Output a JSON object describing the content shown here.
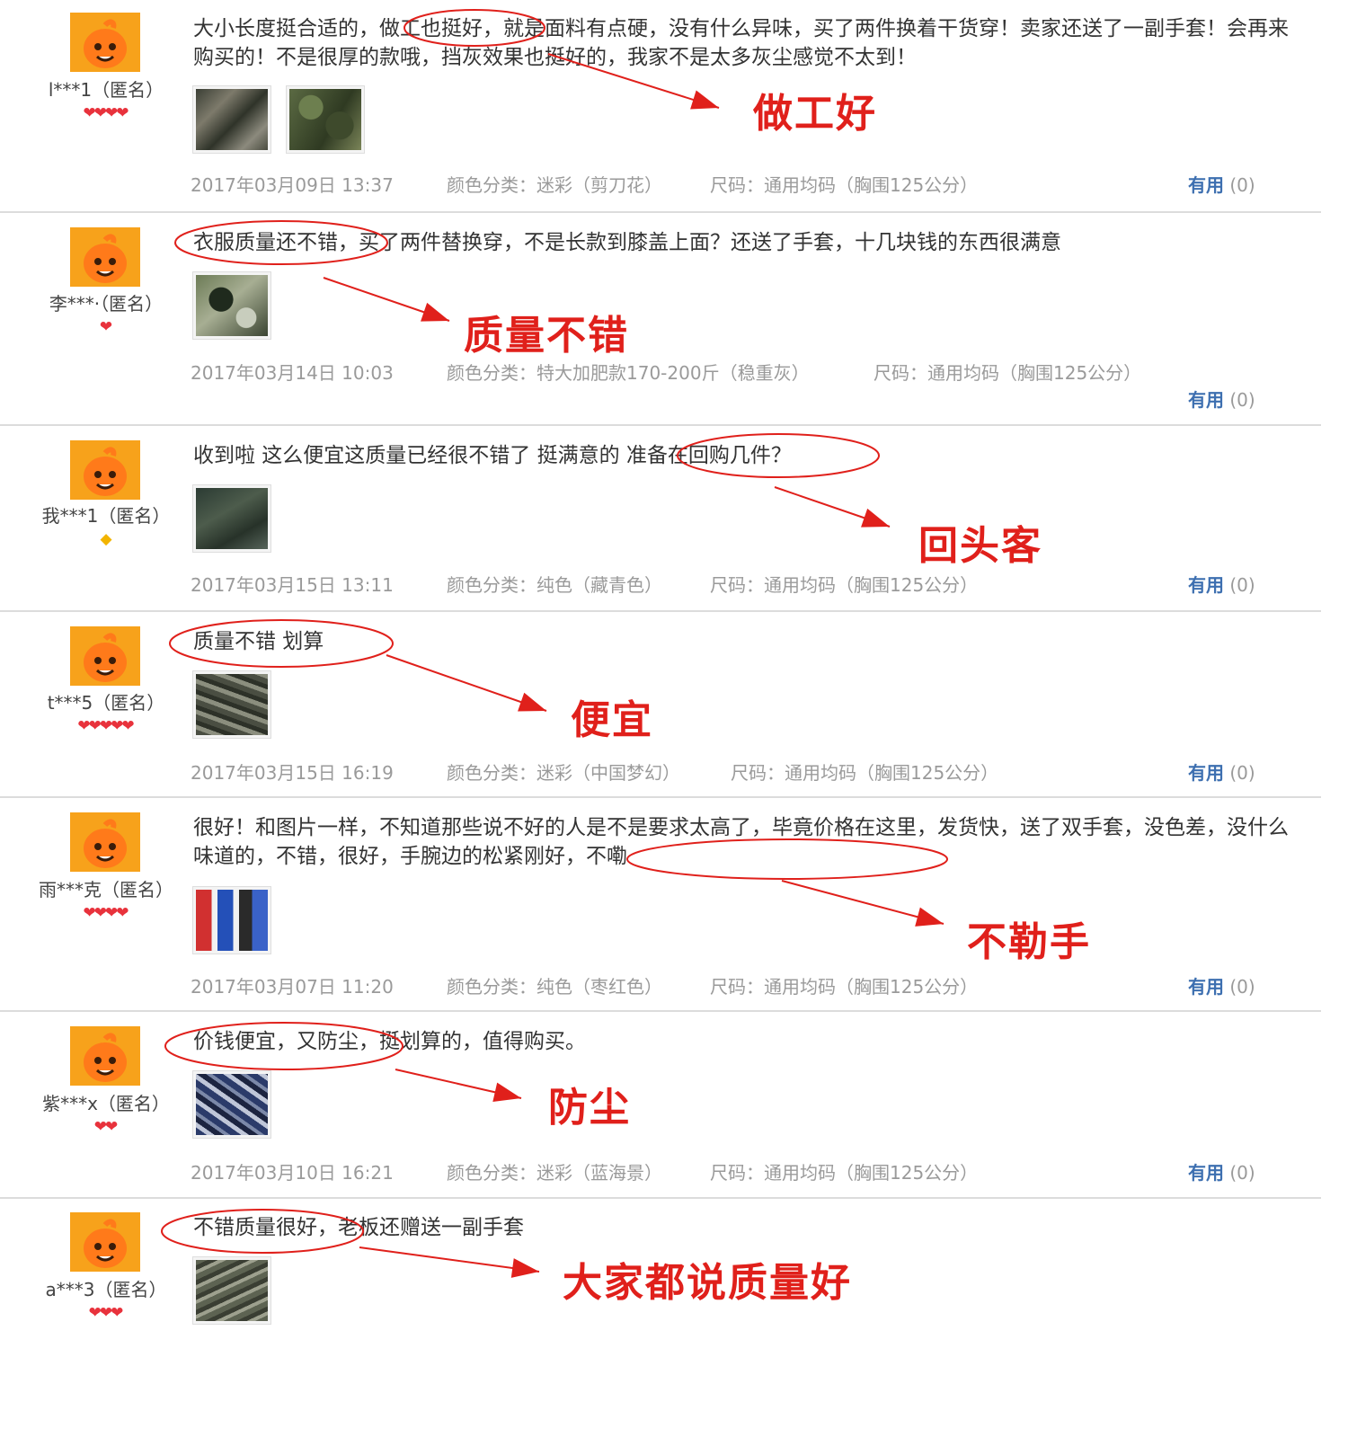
{
  "reviews": [
    {
      "user": "l***1（匿名）",
      "level": {
        "type": "heart",
        "count": 4
      },
      "text": "大小长度挺合适的，做工也挺好，就是面料有点硬，没有什么异味，买了两件换着干货穿！卖家还送了一副手套！会再来购买的！不是很厚的款哦，挡灰效果也挺好的，我家不是太多灰尘感觉不太到！",
      "photos": [
        "camo1",
        "camo2"
      ],
      "date": "2017年03月09日 13:37",
      "color": "颜色分类：迷彩（剪刀花）",
      "size": "尺码：通用均码（胸围125公分）",
      "useful_label": "有用",
      "useful_count": "(0)",
      "tag": "做工好"
    },
    {
      "user": "李***·（匿名）",
      "level": {
        "type": "heart",
        "count": 1
      },
      "text": "衣服质量还不错，买了两件替换穿，不是长款到膝盖上面？还送了手套，十几块钱的东西很满意",
      "photos": [
        "camo3"
      ],
      "date": "2017年03月14日 10:03",
      "color": "颜色分类：特大加肥款170-200斤（稳重灰）",
      "size": "尺码：通用均码（胸围125公分）",
      "useful_label": "有用",
      "useful_count": "(0)",
      "tag": "质量不错"
    },
    {
      "user": "我***1（匿名）",
      "level": {
        "type": "diamond",
        "count": 1
      },
      "text": "收到啦 这么便宜这质量已经很不错了 挺满意的 准备在回购几件？",
      "photos": [
        "green"
      ],
      "date": "2017年03月15日 13:11",
      "color": "颜色分类：纯色（藏青色）",
      "size": "尺码：通用均码（胸围125公分）",
      "useful_label": "有用",
      "useful_count": "(0)",
      "tag": "回头客"
    },
    {
      "user": "t***5（匿名）",
      "level": {
        "type": "heart",
        "count": 5
      },
      "text": "质量不错 划算",
      "photos": [
        "pile"
      ],
      "date": "2017年03月15日 16:19",
      "color": "颜色分类：迷彩（中国梦幻）",
      "size": "尺码：通用均码（胸围125公分）",
      "useful_label": "有用",
      "useful_count": "(0)",
      "tag": "便宜"
    },
    {
      "user": "雨***克（匿名）",
      "level": {
        "type": "heart",
        "count": 4
      },
      "text": "很好！和图片一样，不知道那些说不好的人是不是要求太高了，毕竟价格在这里，发货快，送了双手套，没色差，没什么味道的，不错，很好，手腕边的松紧刚好，不嘞",
      "photos": [
        "people"
      ],
      "date": "2017年03月07日 11:20",
      "color": "颜色分类：纯色（枣红色）",
      "size": "尺码：通用均码（胸围125公分）",
      "useful_label": "有用",
      "useful_count": "(0)",
      "tag": "不勒手"
    },
    {
      "user": "紫***x（匿名）",
      "level": {
        "type": "heart",
        "count": 2
      },
      "text": "价钱便宜，又防尘，挺划算的，值得购买。",
      "photos": [
        "blue"
      ],
      "date": "2017年03月10日 16:21",
      "color": "颜色分类：迷彩（蓝海景）",
      "size": "尺码：通用均码（胸围125公分）",
      "useful_label": "有用",
      "useful_count": "(0)",
      "tag": "防尘"
    },
    {
      "user": "a***3（匿名）",
      "level": {
        "type": "heart",
        "count": 3
      },
      "text": "不错质量很好，老板还赠送一副手套",
      "photos": [
        "gray"
      ],
      "date": "",
      "color": "",
      "size": "",
      "useful_label": "",
      "useful_count": "",
      "tag": "大家都说质量好"
    }
  ],
  "colors": {
    "annotation": "#e0201b",
    "useful": "#3d6fb0",
    "meta": "#9a9a9a",
    "separator": "#dcdcdc"
  },
  "icons": {
    "avatar": "orange-mascot-avatar-icon",
    "heart": "heart-icon",
    "diamond": "diamond-icon"
  }
}
